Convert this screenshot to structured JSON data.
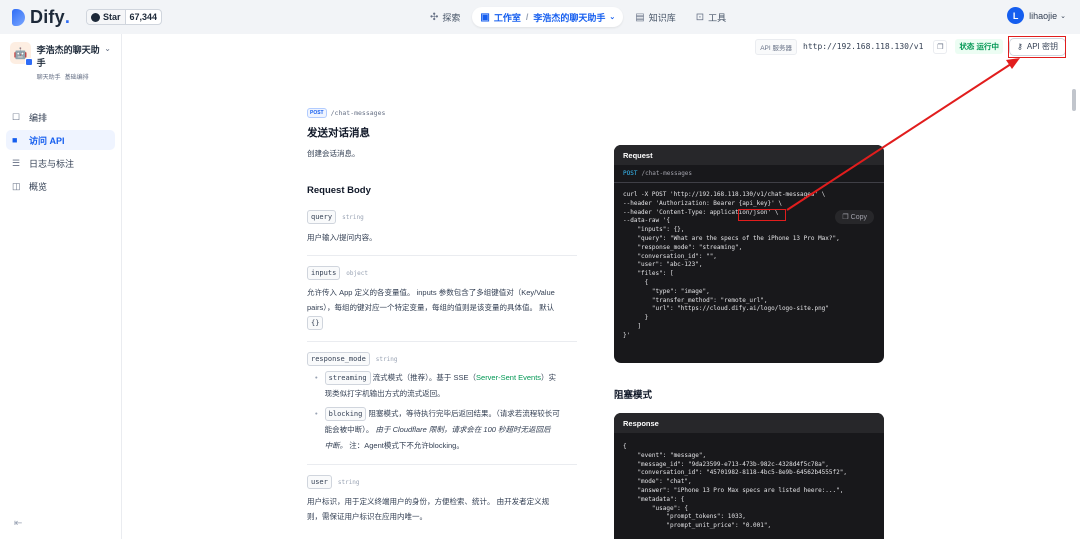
{
  "brand": {
    "name": "Dify",
    "dot": "."
  },
  "github": {
    "label": "Star",
    "count": "67,344"
  },
  "nav": {
    "explore": "探索",
    "studio": "工作室",
    "app": "李浩杰的聊天助手",
    "knowledge": "知识库",
    "tools": "工具"
  },
  "user": {
    "initial": "L",
    "name": "lihaojie"
  },
  "app": {
    "name": "李浩杰的聊天助手",
    "type": "聊天助手",
    "mode": "基础编排"
  },
  "sidebar": {
    "items": [
      {
        "label": "编排"
      },
      {
        "label": "访问 API"
      },
      {
        "label": "日志与标注"
      },
      {
        "label": "概览"
      }
    ]
  },
  "apibar": {
    "label": "API 服务器",
    "url": "http://192.168.118.130/v1",
    "status": "状态 运行中",
    "key_button": "API 密钥"
  },
  "doc": {
    "method": "POST",
    "path": "/chat-messages",
    "title": "发送对话消息",
    "desc": "创建会话消息。",
    "request_body": "Request Body",
    "query": {
      "name": "query",
      "type": "string",
      "desc": "用户输入/提问内容。"
    },
    "inputs": {
      "name": "inputs",
      "type": "object",
      "desc1": "允许传入 App 定义的各变量值。 inputs 参数包含了多组键值对（Key/Value",
      "desc2": "pairs），每组的键对应一个特定变量，每组的值则是该变量的具体值。 默认",
      "default": "{}"
    },
    "response_mode": {
      "name": "response_mode",
      "type": "string",
      "streaming": "streaming",
      "streaming_desc1": "流式模式（推荐）。基于 SSE（",
      "sse": "Server-Sent Events",
      "streaming_desc2": "）实",
      "streaming_desc3": "现类似打字机输出方式的流式返回。",
      "blocking": "blocking",
      "blocking_desc1": "阻塞模式，等待执行完毕后返回结果。（请求若流程较长可",
      "blocking_desc2": "能会被中断）。",
      "blocking_desc3": "由于 Cloudflare 限制，请求会在 100 秒超时无返回后",
      "blocking_desc4": "中断。",
      "blocking_desc5": "注：Agent模式下不允许blocking。"
    },
    "user": {
      "name": "user",
      "type": "string",
      "desc1": "用户标识，用于定义终端用户的身份，方便检索、统计。 由开发者定义规",
      "desc2": "则，需保证用户标识在应用内唯一。"
    },
    "blocking_mode_title": "阻塞模式"
  },
  "request_panel": {
    "title": "Request",
    "method": "POST",
    "path": "/chat-messages",
    "copy": "Copy",
    "code": "curl -X POST 'http://192.168.118.130/v1/chat-messages' \\\n--header 'Authorization: Bearer {api_key}' \\\n--header 'Content-Type: application/json' \\\n--data-raw '{\n    \"inputs\": {},\n    \"query\": \"What are the specs of the iPhone 13 Pro Max?\",\n    \"response_mode\": \"streaming\",\n    \"conversation_id\": \"\",\n    \"user\": \"abc-123\",\n    \"files\": [\n      {\n        \"type\": \"image\",\n        \"transfer_method\": \"remote_url\",\n        \"url\": \"https://cloud.dify.ai/logo/logo-site.png\"\n      }\n    ]\n}'"
  },
  "response_panel": {
    "title": "Response",
    "code": "{\n    \"event\": \"message\",\n    \"message_id\": \"9da23599-e713-473b-982c-4328d4f5c78a\",\n    \"conversation_id\": \"45701982-8118-4bc5-8e9b-64562b4555f2\",\n    \"mode\": \"chat\",\n    \"answer\": \"iPhone 13 Pro Max specs are listed heere:...\",\n    \"metadata\": {\n        \"usage\": {\n            \"prompt_tokens\": 1033,\n            \"prompt_unit_price\": \"0.001\","
  }
}
